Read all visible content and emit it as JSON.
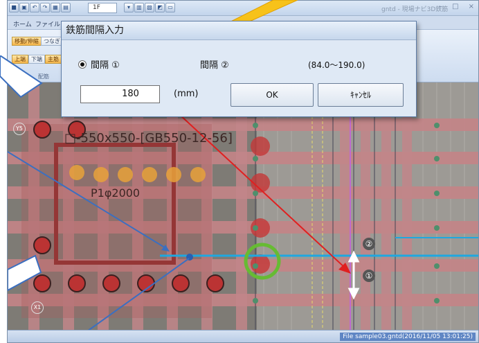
{
  "window": {
    "floor": "1F",
    "title": "gntd - 現場ナビ3D鉄筋",
    "controls": [
      "–",
      "□",
      "×"
    ]
  },
  "ribbon": {
    "tabs": [
      "ホーム",
      "ファイル"
    ],
    "buttons": [
      "移動/伸縮",
      "つなぎ",
      "上端",
      "下端",
      "主筋"
    ],
    "group_label": "配筋"
  },
  "drawing": {
    "section_label": "□-550x550-[GB550-12-56]",
    "pile_label": "P1φ2000",
    "grid_labels": [
      "Y5",
      "X1"
    ],
    "callouts": [
      "②",
      "①"
    ]
  },
  "dialog": {
    "title": "鉄筋間隔入力",
    "option1_label": "間隔 ①",
    "option2_label": "間隔 ②",
    "range_text": "(84.0～190.0)",
    "value": "180",
    "unit": "(mm)",
    "ok_label": "OK",
    "cancel_label": "ｷｬﾝｾﾙ",
    "selected_option": 1
  },
  "status": {
    "file_text": "File sample03.gntd(2016/11/05 13:01:25)"
  },
  "colors": {
    "accent_blue": "#1ea8e0",
    "arrow_red": "#e02020",
    "highlight_green": "#66bb33",
    "callout_yellow": "#f7c21a"
  }
}
